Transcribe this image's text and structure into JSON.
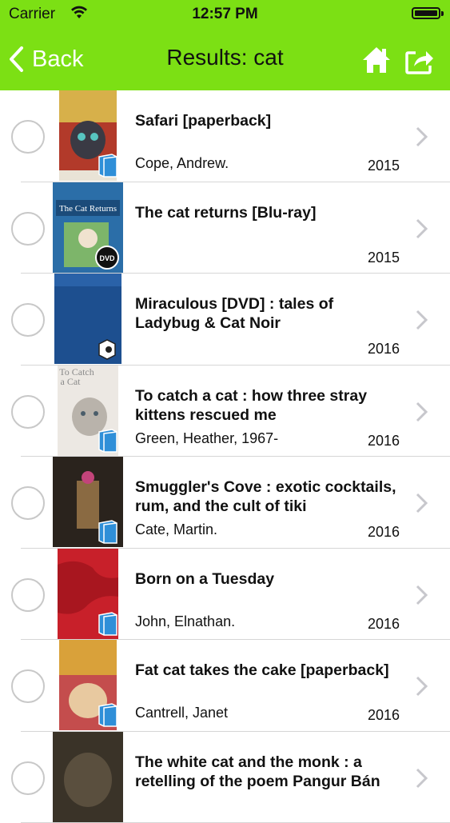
{
  "status": {
    "carrier": "Carrier",
    "time": "12:57 PM"
  },
  "nav": {
    "back_label": "Back",
    "title": "Results: cat",
    "accent_color": "#7ce014"
  },
  "results": [
    {
      "title": "Safari [paperback]",
      "author": "Cope, Andrew.",
      "year": "2015",
      "format": "book-icon",
      "cover_color": "#b23a2a"
    },
    {
      "title": "The cat returns [Blu-ray]",
      "author": "",
      "year": "2015",
      "format": "dvd-icon",
      "cover_color": "#2b6ea8"
    },
    {
      "title": "Miraculous [DVD] : tales of Ladybug & Cat Noir",
      "author": "",
      "year": "2016",
      "format": "video-icon",
      "cover_color": "#1d4f8f"
    },
    {
      "title": "To catch a cat : how three stray kittens rescued me",
      "author": "Green, Heather, 1967-",
      "year": "2016",
      "format": "book-icon",
      "cover_color": "#e8e4df"
    },
    {
      "title": "Smuggler's Cove : exotic cocktails, rum, and the cult of tiki",
      "author": "Cate, Martin.",
      "year": "2016",
      "format": "book-icon",
      "cover_color": "#2a231d"
    },
    {
      "title": "Born on a Tuesday",
      "author": "John, Elnathan.",
      "year": "2016",
      "format": "book-icon",
      "cover_color": "#c8202a"
    },
    {
      "title": "Fat cat takes the cake [paperback]",
      "author": "Cantrell, Janet",
      "year": "2016",
      "format": "book-icon",
      "cover_color": "#c44d4d"
    },
    {
      "title": "The white cat and the monk : a retelling of the poem Pangur Bán",
      "author": "",
      "year": "",
      "format": "book-icon",
      "cover_color": "#3a3328"
    }
  ]
}
